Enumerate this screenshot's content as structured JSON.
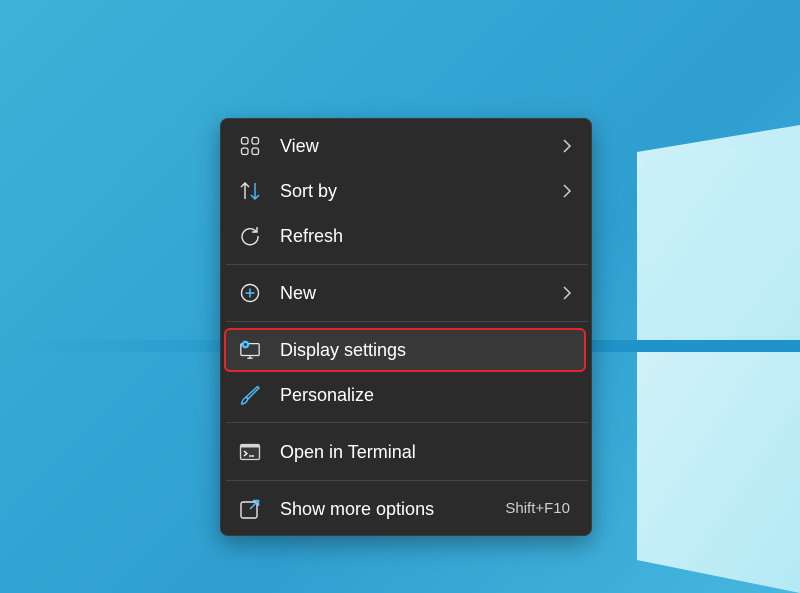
{
  "context_menu": {
    "items": [
      {
        "label": "View",
        "icon": "view-grid-icon",
        "submenu": true
      },
      {
        "label": "Sort by",
        "icon": "sort-arrows-icon",
        "submenu": true
      },
      {
        "label": "Refresh",
        "icon": "refresh-icon",
        "submenu": false
      },
      {
        "label": "New",
        "icon": "plus-circle-icon",
        "submenu": true
      },
      {
        "label": "Display settings",
        "icon": "display-settings-icon",
        "submenu": false,
        "highlighted": true
      },
      {
        "label": "Personalize",
        "icon": "brush-icon",
        "submenu": false
      },
      {
        "label": "Open in Terminal",
        "icon": "terminal-icon",
        "submenu": false
      },
      {
        "label": "Show more options",
        "icon": "show-more-icon",
        "submenu": false,
        "shortcut": "Shift+F10"
      }
    ]
  },
  "colors": {
    "menu_background": "#2b2b2b",
    "highlight_outline": "#e3262a",
    "accent": "#4cc2ff",
    "wallpaper": "#33a6d4"
  }
}
